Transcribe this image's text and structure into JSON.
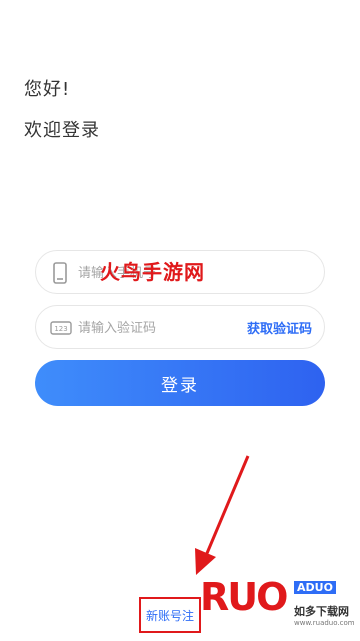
{
  "header": {
    "greeting": "您好!",
    "welcome": "欢迎登录"
  },
  "form": {
    "phone_placeholder": "请输入手机号",
    "code_placeholder": "请输入验证码",
    "get_code_label": "获取验证码",
    "login_label": "登录"
  },
  "overlay": {
    "watermark_text": "火鸟手游网"
  },
  "footer": {
    "new_account_label": "新账号注"
  },
  "logo": {
    "main": "RUO",
    "badge": "ADUO",
    "sub": "如多下载网",
    "url": "www.ruaduo.com"
  },
  "icons": {
    "phone": "phone-icon",
    "code": "code-123-icon",
    "arrow": "red-arrow"
  },
  "colors": {
    "accent": "#2e6df6",
    "button_start": "#3f8dfb",
    "button_end": "#2e62f0",
    "annotation_red": "#e0191b"
  }
}
